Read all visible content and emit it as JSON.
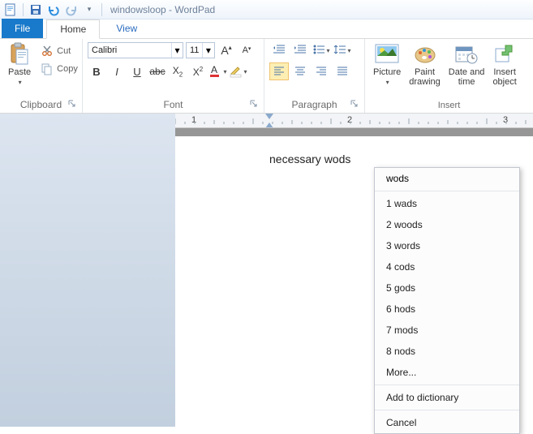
{
  "window": {
    "title": "windowsloop - WordPad"
  },
  "tabs": {
    "file": "File",
    "home": "Home",
    "view": "View"
  },
  "clipboard": {
    "group": "Clipboard",
    "paste": "Paste",
    "cut": "Cut",
    "copy": "Copy"
  },
  "font": {
    "group": "Font",
    "name": "Calibri",
    "size": "11"
  },
  "paragraph": {
    "group": "Paragraph"
  },
  "insert": {
    "group": "Insert",
    "picture": "Picture",
    "paint": "Paint\ndrawing",
    "datetime": "Date and\ntime",
    "object": "Insert\nobject"
  },
  "ruler": {
    "n1": "1",
    "n2": "2",
    "n3": "3"
  },
  "document": {
    "text": "necessary wods"
  },
  "context": {
    "head": "wods",
    "suggestions": [
      {
        "n": "1",
        "w": "wads"
      },
      {
        "n": "2",
        "w": "woods"
      },
      {
        "n": "3",
        "w": "words"
      },
      {
        "n": "4",
        "w": "cods"
      },
      {
        "n": "5",
        "w": "gods"
      },
      {
        "n": "6",
        "w": "hods"
      },
      {
        "n": "7",
        "w": "mods"
      },
      {
        "n": "8",
        "w": "nods"
      }
    ],
    "more": "More...",
    "add": "Add to dictionary",
    "cancel": "Cancel"
  }
}
